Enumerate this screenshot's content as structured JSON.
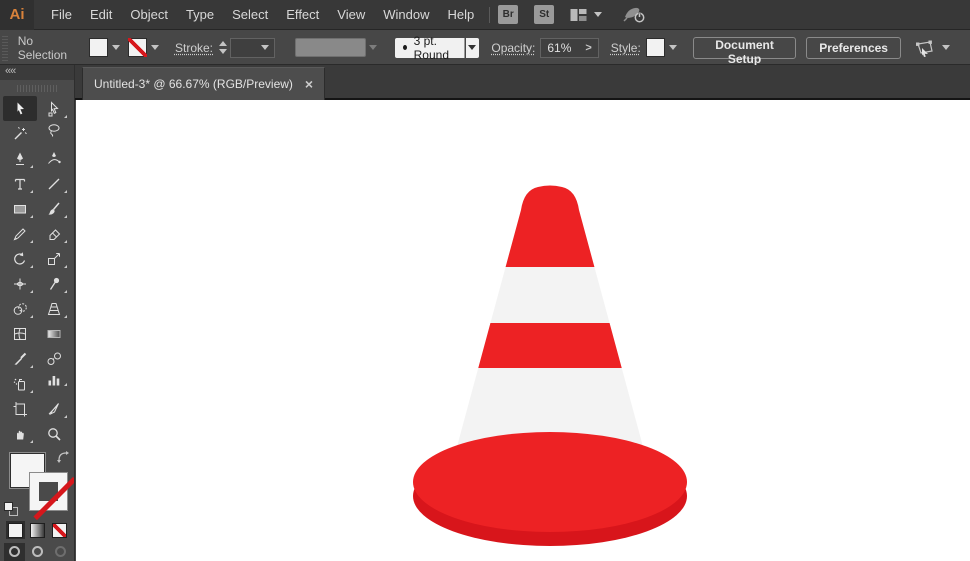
{
  "app": {
    "logo_text": "Ai"
  },
  "menu_bar": {
    "items": [
      "File",
      "Edit",
      "Object",
      "Type",
      "Select",
      "Effect",
      "View",
      "Window",
      "Help"
    ],
    "bridge_button": "Br",
    "stock_button": "St"
  },
  "control_bar": {
    "selection_status": "No Selection",
    "stroke_label": "Stroke:",
    "brush_definition": "3 pt. Round",
    "opacity_label": "Opacity:",
    "opacity_value": "61%",
    "opacity_expand_glyph": ">",
    "style_label": "Style:",
    "document_setup_button": "Document Setup",
    "preferences_button": "Preferences"
  },
  "document_tab": {
    "title": "Untitled-3* @ 66.67% (RGB/Preview)",
    "close_glyph": "×"
  },
  "toolbar": {
    "collapse_glyph": "««",
    "tools": [
      {
        "name": "selection",
        "active": true,
        "flyout": false
      },
      {
        "name": "direct-selection",
        "active": false,
        "flyout": true
      },
      {
        "name": "magic-wand",
        "active": false,
        "flyout": false
      },
      {
        "name": "lasso",
        "active": false,
        "flyout": false
      },
      {
        "name": "pen",
        "active": false,
        "flyout": true
      },
      {
        "name": "curvature",
        "active": false,
        "flyout": false
      },
      {
        "name": "type",
        "active": false,
        "flyout": true
      },
      {
        "name": "line-segment",
        "active": false,
        "flyout": true
      },
      {
        "name": "rectangle",
        "active": false,
        "flyout": true
      },
      {
        "name": "paintbrush",
        "active": false,
        "flyout": true
      },
      {
        "name": "shaper",
        "active": false,
        "flyout": true
      },
      {
        "name": "eraser",
        "active": false,
        "flyout": true
      },
      {
        "name": "rotate",
        "active": false,
        "flyout": true
      },
      {
        "name": "scale",
        "active": false,
        "flyout": true
      },
      {
        "name": "width",
        "active": false,
        "flyout": true
      },
      {
        "name": "puppet-warp",
        "active": false,
        "flyout": true
      },
      {
        "name": "shape-builder",
        "active": false,
        "flyout": true
      },
      {
        "name": "perspective-grid",
        "active": false,
        "flyout": true
      },
      {
        "name": "mesh",
        "active": false,
        "flyout": false
      },
      {
        "name": "gradient",
        "active": false,
        "flyout": false
      },
      {
        "name": "eyedropper",
        "active": false,
        "flyout": true
      },
      {
        "name": "blend",
        "active": false,
        "flyout": false
      },
      {
        "name": "symbol-sprayer",
        "active": false,
        "flyout": true
      },
      {
        "name": "column-graph",
        "active": false,
        "flyout": true
      },
      {
        "name": "artboard",
        "active": false,
        "flyout": false
      },
      {
        "name": "slice",
        "active": false,
        "flyout": true
      },
      {
        "name": "hand",
        "active": false,
        "flyout": true
      },
      {
        "name": "zoom",
        "active": false,
        "flyout": false
      }
    ]
  },
  "canvas": {
    "cone": {
      "red": "#ED2224",
      "dark_red": "#D8151B",
      "stripe_white": "#F3F3F3"
    }
  },
  "colors": {
    "ai_logo_orange": "#D9823B",
    "none_slash_red": "#D6171C",
    "ui_dark_gray": "#474747"
  }
}
